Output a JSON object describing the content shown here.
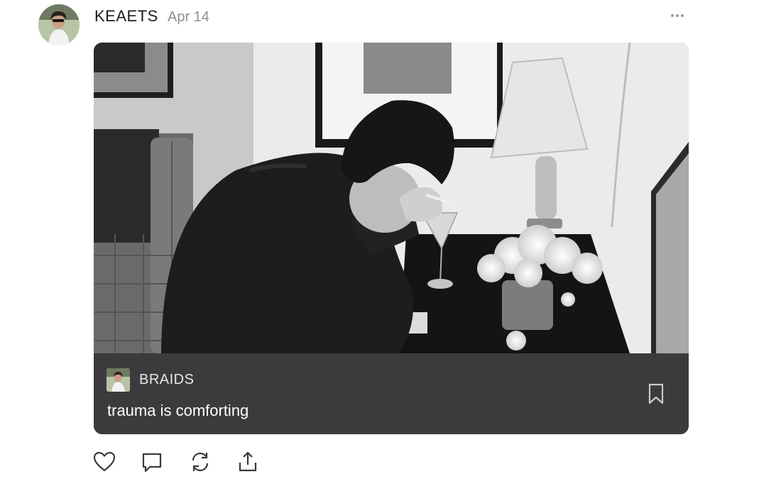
{
  "post": {
    "author": "KEAETS",
    "date": "Apr 14",
    "more_icon": "ellipsis-icon"
  },
  "card": {
    "source_author": "BRAIDS",
    "caption": "trauma is comforting",
    "bookmark_icon": "bookmark-icon"
  },
  "actions": [
    "heart-icon",
    "comment-icon",
    "reblog-icon",
    "share-icon"
  ],
  "colors": {
    "card_footer": "#3b3a3d",
    "text_primary": "#1c1c1e",
    "text_secondary": "#8e8e93"
  }
}
